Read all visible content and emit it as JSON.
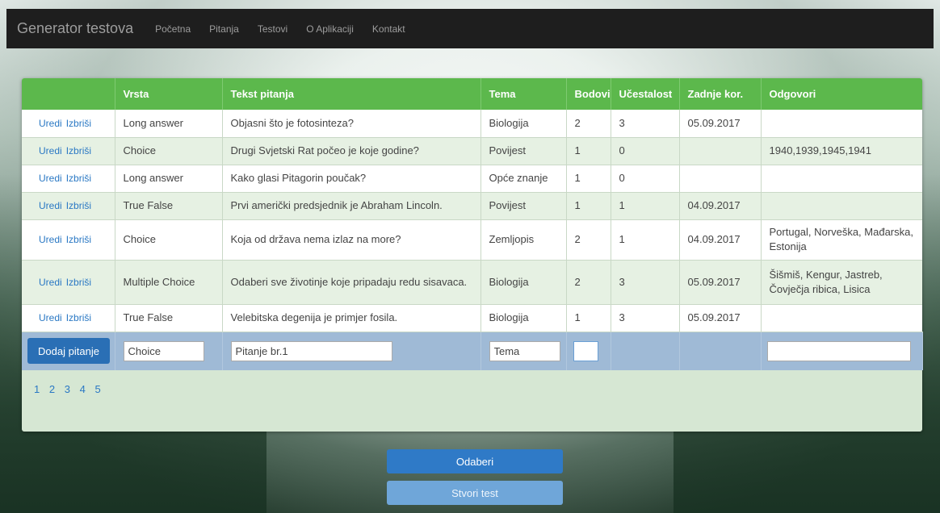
{
  "navbar": {
    "brand": "Generator testova",
    "links": [
      "Početna",
      "Pitanja",
      "Testovi",
      "O Aplikaciji",
      "Kontakt"
    ]
  },
  "table": {
    "headers": [
      "",
      "Vrsta",
      "Tekst pitanja",
      "Tema",
      "Bodovi",
      "Učestalost",
      "Zadnje kor.",
      "Odgovori"
    ],
    "edit_label": "Uredi",
    "delete_label": "Izbriši",
    "rows": [
      {
        "vrsta": "Long answer",
        "tekst": "Objasni što je fotosinteza?",
        "tema": "Biologija",
        "bodovi": "2",
        "ucestalost": "3",
        "zadnje": "05.09.2017",
        "odgovori": ""
      },
      {
        "vrsta": "Choice",
        "tekst": "Drugi Svjetski Rat počeo je koje godine?",
        "tema": "Povijest",
        "bodovi": "1",
        "ucestalost": "0",
        "zadnje": "",
        "odgovori": "1940,1939,1945,1941"
      },
      {
        "vrsta": "Long answer",
        "tekst": "Kako glasi Pitagorin poučak?",
        "tema": "Opće znanje",
        "bodovi": "1",
        "ucestalost": "0",
        "zadnje": "",
        "odgovori": ""
      },
      {
        "vrsta": "True False",
        "tekst": "Prvi američki predsjednik je Abraham Lincoln.",
        "tema": "Povijest",
        "bodovi": "1",
        "ucestalost": "1",
        "zadnje": "04.09.2017",
        "odgovori": ""
      },
      {
        "vrsta": "Choice",
        "tekst": "Koja od država nema izlaz na more?",
        "tema": "Zemljopis",
        "bodovi": "2",
        "ucestalost": "1",
        "zadnje": "04.09.2017",
        "odgovori": "Portugal, Norveška, Mađarska, Estonija"
      },
      {
        "vrsta": "Multiple Choice",
        "tekst": "Odaberi sve životinje koje pripadaju redu sisavaca.",
        "tema": "Biologija",
        "bodovi": "2",
        "ucestalost": "3",
        "zadnje": "05.09.2017",
        "odgovori": "Šišmiš, Kengur, Jastreb, Čovječja ribica, Lisica"
      },
      {
        "vrsta": "True False",
        "tekst": "Velebitska degenija je primjer fosila.",
        "tema": "Biologija",
        "bodovi": "1",
        "ucestalost": "3",
        "zadnje": "05.09.2017",
        "odgovori": ""
      }
    ]
  },
  "add_row": {
    "button_label": "Dodaj pitanje",
    "vrsta_value": "Choice",
    "tekst_value": "Pitanje br.1",
    "tema_value": "Tema",
    "bodovi_value": "",
    "odgovori_value": ""
  },
  "pagination": [
    "1",
    "2",
    "3",
    "4",
    "5"
  ],
  "actions": {
    "odaberi": "Odaberi",
    "stvori": "Stvori test"
  }
}
